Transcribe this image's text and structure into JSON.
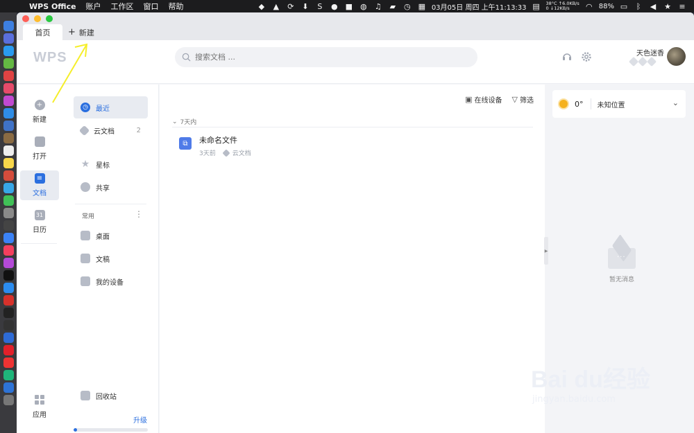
{
  "menubar": {
    "app_name": "WPS Office",
    "menus": [
      "账户",
      "工作区",
      "窗口",
      "帮助"
    ],
    "datetime": "03月05日 周四 上午11:13:33",
    "temp_status": "38°C",
    "cpu_status": "0",
    "net_up": "↑6.0KB/s",
    "net_down": "↓12KB/s",
    "battery": "88%"
  },
  "tabs": {
    "home": "首页",
    "new": "新建"
  },
  "header": {
    "logo": "WPS",
    "search_placeholder": "搜索文档 ...",
    "username": "天色迷香"
  },
  "rail": {
    "new": "新建",
    "open": "打开",
    "docs": "文档",
    "calendar": "日历",
    "calendar_number": "31",
    "apps": "应用"
  },
  "sidebar": {
    "recent": "最近",
    "cloud": "云文档",
    "cloud_count": "2",
    "starred": "星标",
    "shared": "共享",
    "common_heading": "常用",
    "desktop": "桌面",
    "documents": "文稿",
    "my_devices": "我的设备",
    "trash": "回收站",
    "upgrade": "升级",
    "storage_used_fraction": 0.05
  },
  "main": {
    "online_devices": "在线设备",
    "filter": "筛选",
    "group_label": "7天内",
    "files": [
      {
        "name": "未命名文件",
        "time": "3天前",
        "location": "云文档"
      }
    ]
  },
  "right_panel": {
    "temperature": "0°",
    "location": "未知位置",
    "empty_message": "暂无消息"
  },
  "watermark": {
    "brand": "Bai du经验",
    "url": "jingyan.baidu.com"
  },
  "colors": {
    "accent": "#2b6fdf",
    "annotation_arrow": "#f5ee2a"
  }
}
